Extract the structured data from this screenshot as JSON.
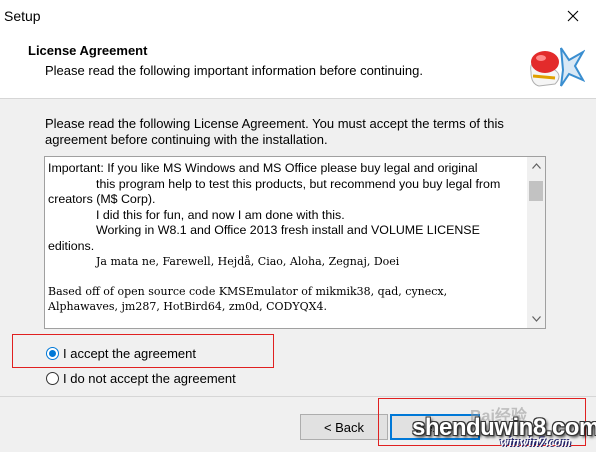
{
  "window": {
    "title": "Setup",
    "close_icon": "close-icon"
  },
  "header": {
    "title": "License Agreement",
    "subtitle": "Please read the following important information before continuing.",
    "logo_icon": "kms-logo-icon"
  },
  "intro": "Please read the following License Agreement. You must accept the terms of this agreement before continuing with the installation.",
  "license": {
    "lines": [
      "Important: If you like MS Windows and MS Office please buy legal and original",
      "this program help to test this products, but recommend you buy legal from",
      "creators (M$ Corp).",
      "I did this for fun, and now I am done with this.",
      "Working in W8.1 and Office 2013 fresh install and VOLUME LICENSE",
      "editions.",
      "Ja mata ne, Farewell, Hejdå, Ciao, Aloha, Zegnaj, Doei",
      "Based off of open source code KMSEmulator of mikmik38, qad, cynecx,",
      "Alphawaves, jm287, HotBird64, zm0d, CODYQX4."
    ]
  },
  "options": {
    "accept_label": "I accept the agreement",
    "decline_label": "I do not accept the agreement",
    "selected": "accept"
  },
  "buttons": {
    "back": "< Back",
    "next": "Next >"
  },
  "watermark": {
    "main": "shenduwin8.com",
    "faint": "Bai经验",
    "small": "winwin7.com"
  },
  "colors": {
    "accent": "#0078d7",
    "highlight_box": "#e02020"
  }
}
